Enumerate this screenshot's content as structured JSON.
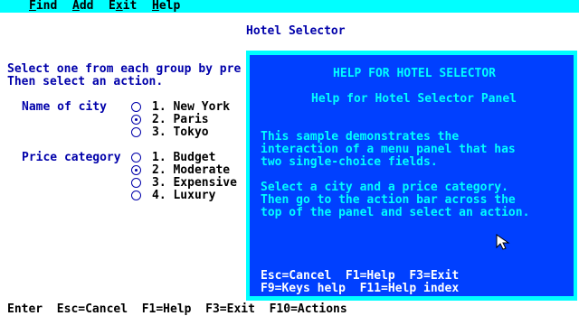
{
  "menu": [
    {
      "mnemonic": "F",
      "rest": "ind"
    },
    {
      "mnemonic": "A",
      "rest": "dd"
    },
    {
      "mnemonic": "E",
      "rest": "xit",
      "prefix": ""
    },
    {
      "mnemonic": "H",
      "rest": "elp"
    }
  ],
  "panel": {
    "title": "Hotel Selector",
    "instruction1": "Select one from each group by pre",
    "instruction2": "Then select an action."
  },
  "city": {
    "label": "Name of city",
    "options": [
      {
        "text": "1. New York",
        "selected": false
      },
      {
        "text": "2. Paris",
        "selected": true
      },
      {
        "text": "3. Tokyo",
        "selected": false
      }
    ]
  },
  "price": {
    "label": "Price category",
    "options": [
      {
        "text": "1. Budget",
        "selected": false
      },
      {
        "text": "2. Moderate",
        "selected": true
      },
      {
        "text": "3. Expensive",
        "selected": false
      },
      {
        "text": "4. Luxury",
        "selected": false
      }
    ]
  },
  "help": {
    "title": "HELP FOR HOTEL SELECTOR",
    "subtitle": "Help for Hotel Selector Panel",
    "para1": [
      "This sample demonstrates the",
      "interaction of a menu panel that has",
      "two single-choice fields."
    ],
    "para2": [
      "Select a city and a price category.",
      "Then go to the action bar across the",
      "top of the panel and select an action."
    ],
    "keys1": "Esc=Cancel  F1=Help  F3=Exit",
    "keys2": "F9=Keys help  F11=Help index"
  },
  "function_keys": "Enter  Esc=Cancel  F1=Help  F3=Exit  F10=Actions",
  "colors": {
    "action_bar": "#00ffff",
    "help_bg": "#0040ff",
    "field_text": "#0000aa"
  }
}
